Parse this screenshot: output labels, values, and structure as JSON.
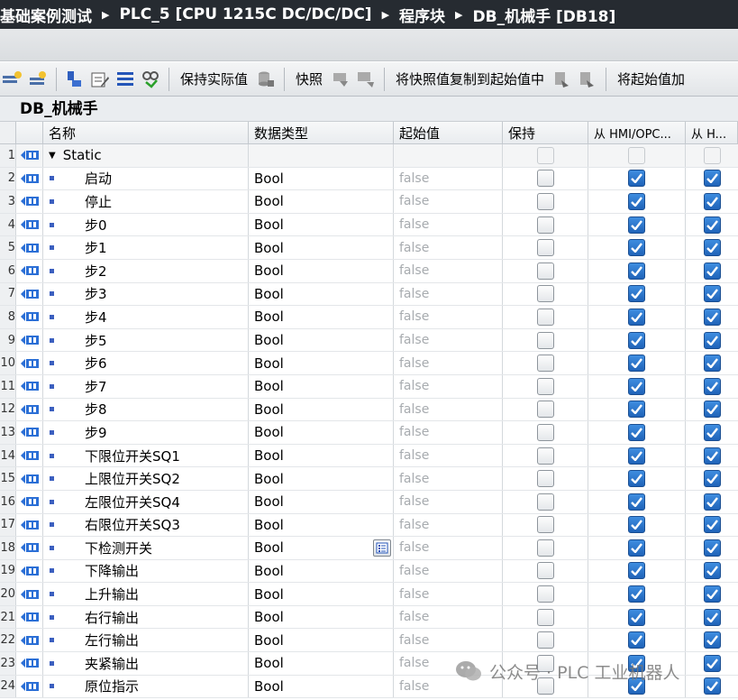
{
  "breadcrumb": [
    "基础案例测试",
    "PLC_5 [CPU 1215C DC/DC/DC]",
    "程序块",
    "DB_机械手 [DB18]"
  ],
  "toolbar": {
    "keep_actual_label": "保持实际值",
    "snapshot_label": "快照",
    "copy_snapshot_label": "将快照值复制到起始值中",
    "load_start_label": "将起始值加"
  },
  "db_title": "DB_机械手",
  "columns": {
    "name": "名称",
    "datatype": "数据类型",
    "start_value": "起始值",
    "retain": "保持",
    "from_hmi": "从 HMI/OPC...",
    "from_h": "从 H..."
  },
  "static_row": {
    "num": "1",
    "name": "Static"
  },
  "rows": [
    {
      "num": "2",
      "name": "启动",
      "type": "Bool",
      "start": "false"
    },
    {
      "num": "3",
      "name": "停止",
      "type": "Bool",
      "start": "false"
    },
    {
      "num": "4",
      "name": "步0",
      "type": "Bool",
      "start": "false"
    },
    {
      "num": "5",
      "name": "步1",
      "type": "Bool",
      "start": "false"
    },
    {
      "num": "6",
      "name": "步2",
      "type": "Bool",
      "start": "false"
    },
    {
      "num": "7",
      "name": "步3",
      "type": "Bool",
      "start": "false"
    },
    {
      "num": "8",
      "name": "步4",
      "type": "Bool",
      "start": "false"
    },
    {
      "num": "9",
      "name": "步5",
      "type": "Bool",
      "start": "false"
    },
    {
      "num": "10",
      "name": "步6",
      "type": "Bool",
      "start": "false"
    },
    {
      "num": "11",
      "name": "步7",
      "type": "Bool",
      "start": "false"
    },
    {
      "num": "12",
      "name": "步8",
      "type": "Bool",
      "start": "false"
    },
    {
      "num": "13",
      "name": "步9",
      "type": "Bool",
      "start": "false"
    },
    {
      "num": "14",
      "name": "下限位开关SQ1",
      "type": "Bool",
      "start": "false"
    },
    {
      "num": "15",
      "name": "上限位开关SQ2",
      "type": "Bool",
      "start": "false"
    },
    {
      "num": "16",
      "name": "左限位开关SQ4",
      "type": "Bool",
      "start": "false"
    },
    {
      "num": "17",
      "name": "右限位开关SQ3",
      "type": "Bool",
      "start": "false"
    },
    {
      "num": "18",
      "name": "下检测开关",
      "type": "Bool",
      "start": "false"
    },
    {
      "num": "19",
      "name": "下降输出",
      "type": "Bool",
      "start": "false"
    },
    {
      "num": "20",
      "name": "上升输出",
      "type": "Bool",
      "start": "false"
    },
    {
      "num": "21",
      "name": "右行输出",
      "type": "Bool",
      "start": "false"
    },
    {
      "num": "22",
      "name": "左行输出",
      "type": "Bool",
      "start": "false"
    },
    {
      "num": "23",
      "name": "夹紧输出",
      "type": "Bool",
      "start": "false"
    },
    {
      "num": "24",
      "name": "原位指示",
      "type": "Bool",
      "start": "false"
    }
  ],
  "watermark": "公众号 · PLC 工业机器人",
  "colors": {
    "titlebar": "#262b31",
    "checkbox_on": "#2a72c9",
    "start_value_text": "#a7abaf"
  }
}
